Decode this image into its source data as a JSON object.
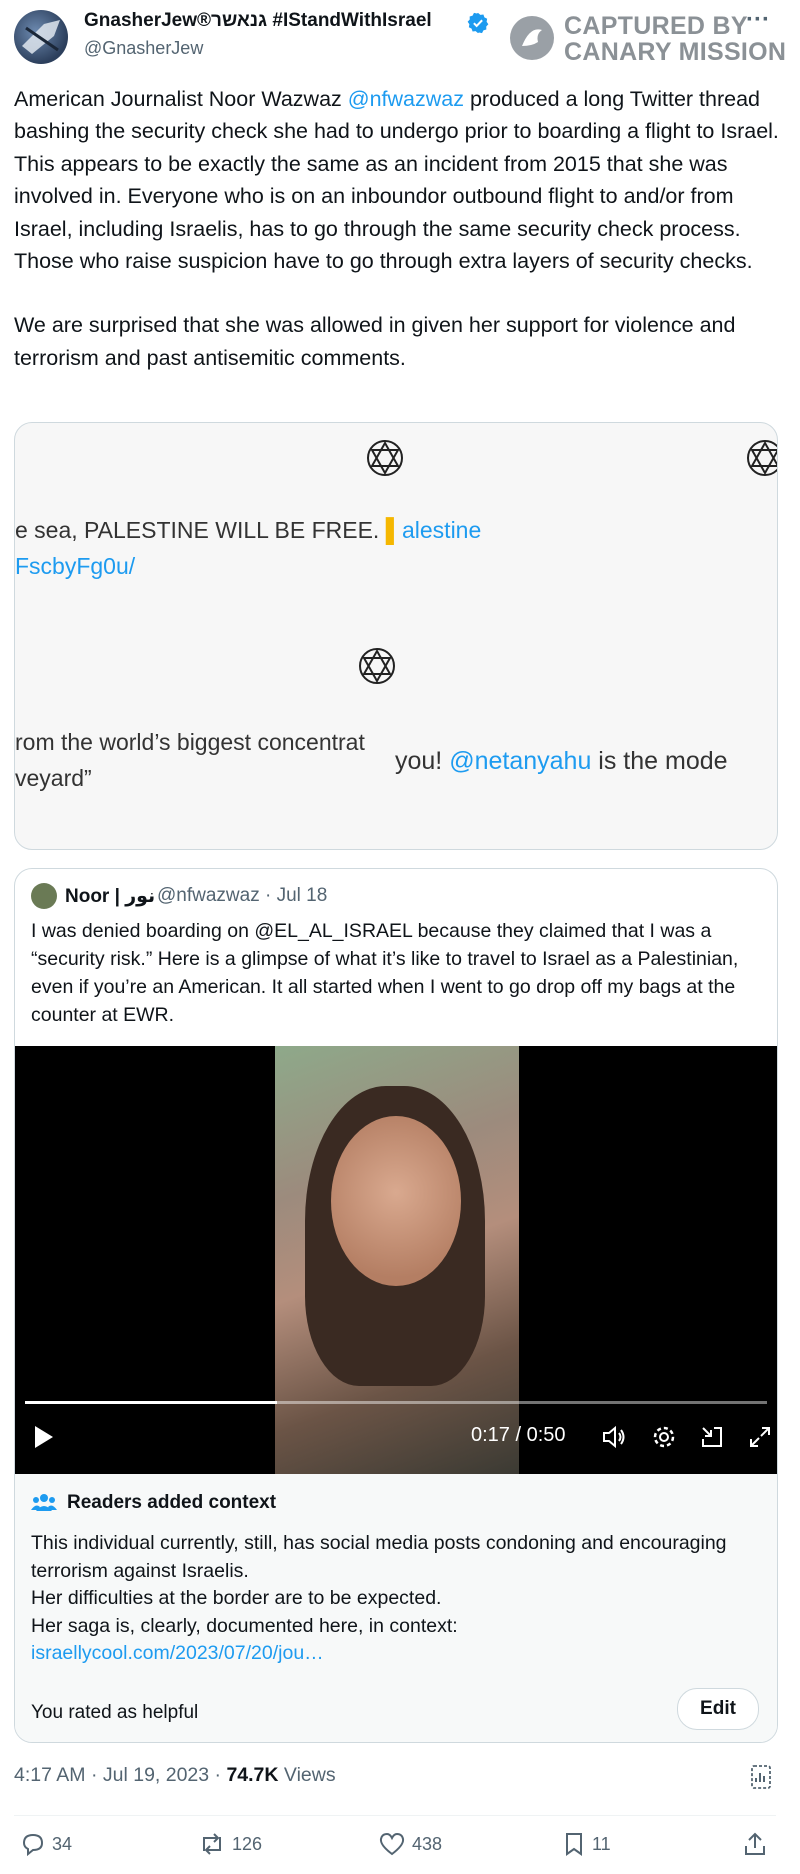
{
  "author": {
    "display_name": "GnasherJew®גנאשר #IStandWithIsrael",
    "handle": "@GnasherJew"
  },
  "watermark": {
    "line1": "CAPTURED BY",
    "line2": "CANARY MISSION",
    "more": "···"
  },
  "tweet": {
    "p1_before": "American Journalist Noor Wazwaz ",
    "p1_mention": "@nfwazwaz",
    "p1_after": " produced a long Twitter thread bashing the security check she had to undergo prior to boarding a flight to Israel. This appears to be exactly the same as an incident from 2015 that she was involved in. Everyone who is on an inboundor outbound flight to and/or from Israel, including Israelis, has to go through the same security check process. Those who raise suspicion have to go through extra layers of security checks.",
    "p2": "We are surprised that she was allowed in given her support for violence and terrorism and past antisemitic comments."
  },
  "media": {
    "text1": "e sea, PALESTINE WILL BE FREE. ",
    "text1_link": "alestine",
    "text2": "FscbyFg0u/",
    "text3": "rom the world’s biggest concentrat",
    "text4": "veyard”",
    "text5": "you! ",
    "text5_mention": "@netanyahu",
    "text5_after": " is the mode"
  },
  "quote": {
    "name": "Noor | نور",
    "handle_date": "@nfwazwaz · Jul 18",
    "text": "I was denied boarding on @EL_AL_ISRAEL because they claimed that I was a “security risk.” Here is a glimpse of what it’s like to travel to Israel as a Palestinian, even if you’re an American. It all started when I went to go drop off my bags at the counter at EWR."
  },
  "video": {
    "time": "0:17 / 0:50",
    "progress": 0.34
  },
  "context": {
    "title": "Readers added context",
    "line1": "This individual currently, still, has social media posts condoning and encouraging terrorism against Israelis.",
    "line2": "Her difficulties at the border are to be expected.",
    "line3": "Her saga is, clearly, documented here, in context:",
    "link": "israellycool.com/2023/07/20/jou…",
    "rated": "You rated as helpful",
    "edit_label": "Edit"
  },
  "meta": {
    "time_date": "4:17 AM · Jul 19, 2023 · ",
    "views_count": "74.7K",
    "views_label": " Views"
  },
  "actions": {
    "replies": "34",
    "reposts": "126",
    "likes": "438",
    "bookmarks": "11"
  },
  "colors": {
    "link": "#1d9bf0",
    "text": "#0f1419",
    "secondary": "#536471",
    "verified": "#1d9bf0"
  }
}
